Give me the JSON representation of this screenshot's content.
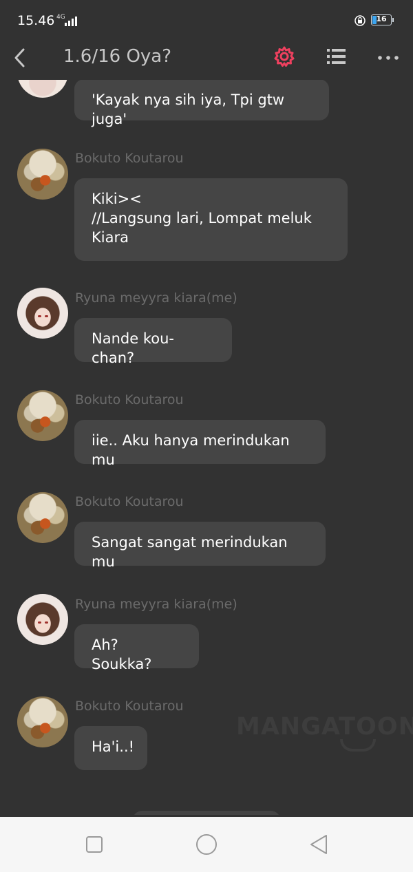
{
  "status_bar": {
    "time": "15.46",
    "network": "4G",
    "battery": "16"
  },
  "app_bar": {
    "title": "1.6/16 Oya?",
    "accent_color": "#f0405f"
  },
  "messages": [
    {
      "sender": "",
      "text": "'Kayak nya sih iya, Tpi gtw juga'",
      "avatar": "partial-avatar"
    },
    {
      "sender": "Bokuto Koutarou",
      "text": "Kiki><\n//Langsung lari, Lompat meluk\nKiara",
      "avatar": "bokuto-avatar"
    },
    {
      "sender": "Ryuna meyyra kiara(me)",
      "text": "Nande kou-chan?",
      "avatar": "ryuna-avatar"
    },
    {
      "sender": "Bokuto Koutarou",
      "text": "iie.. Aku hanya merindukan mu",
      "avatar": "bokuto-avatar"
    },
    {
      "sender": "Bokuto Koutarou",
      "text": "Sangat sangat merindukan mu",
      "avatar": "bokuto-avatar"
    },
    {
      "sender": "Ryuna meyyra kiara(me)",
      "text": "Ah? Soukka?",
      "avatar": "ryuna-avatar"
    },
    {
      "sender": "Bokuto Koutarou",
      "text": "Ha'i..!",
      "avatar": "bokuto-avatar"
    }
  ],
  "watermark": "MANGATOON",
  "nav_bar": {
    "recents": "square-icon",
    "home": "circle-icon",
    "back": "triangle-back-icon"
  }
}
